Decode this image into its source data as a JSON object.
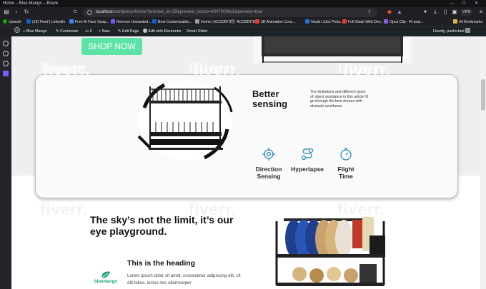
{
  "browser": {
    "window_title": "Home – Blue Mango – Brave",
    "url_host": "localhost",
    "url_path": "/wordpress/home/?preview_id=25&preview_nonce=40470090c5&preview=true",
    "vpn_label": "VPN",
    "all_bookmarks": "All Bookmarks"
  },
  "bookmarks": [
    {
      "label": "Upwork",
      "color": "#14a800"
    },
    {
      "label": "(19) Feed | LinkedIn",
      "color": "#0a66c2"
    },
    {
      "label": "Free AI Face Swap...",
      "color": "#3b82f6"
    },
    {
      "label": "Remove Unwanted...",
      "color": "#6d5cff"
    },
    {
      "label": "Best Customizable...",
      "color": "#0b5ed7"
    },
    {
      "label": "Home | ACODBITE",
      "color": "#999999"
    },
    {
      "label": "ACODBITE",
      "color": "#555555"
    },
    {
      "label": "3D Animation Cons...",
      "color": "#e53935"
    },
    {
      "label": "Naukri Jobs Porta...",
      "color": "#2b6fd6"
    },
    {
      "label": "Full Stack Web Dev...",
      "color": "#e53935"
    },
    {
      "label": "Opus Clip - AI-pow...",
      "color": "#8b5cf6"
    }
  ],
  "admin_bar": {
    "site_name": "Blue Mango",
    "customize": "Customize",
    "comments_count": "0",
    "new_label": "New",
    "edit_page": "Edit Page",
    "elementor": "Edit with Elementor",
    "smart_slider": "Smart Slider",
    "howdy": "Howdy, punlocked"
  },
  "page": {
    "watermark": "fiverr.",
    "shop_button": "SHOP NOW",
    "card": {
      "title_line1": "Better",
      "title_line2": "sensing",
      "description": "The limitations and different types of object avoidance in this article I'll go through the best drones with obstacle avoidance.",
      "features": [
        {
          "line1": "Direction",
          "line2": "Sensing",
          "icon": "crosshair-icon"
        },
        {
          "line1": "Hyperlapse",
          "line2": "",
          "icon": "route-icon"
        },
        {
          "line1": "Flight",
          "line2": "Time",
          "icon": "stopwatch-icon"
        }
      ]
    },
    "tagline": "The sky’s not the limit, it’s our eye playground.",
    "heading": "This is the heading",
    "lorem": "Lorem ipsum dolor sit amet, consectetur adipiscing elit. Ut elit tellus, luctus nec ullamcorper",
    "logo_text": "bluemango"
  },
  "colors": {
    "accent_green": "#5ee3a7",
    "admin_bar": "#1d2327",
    "feature_icon": "#1e88b5"
  }
}
